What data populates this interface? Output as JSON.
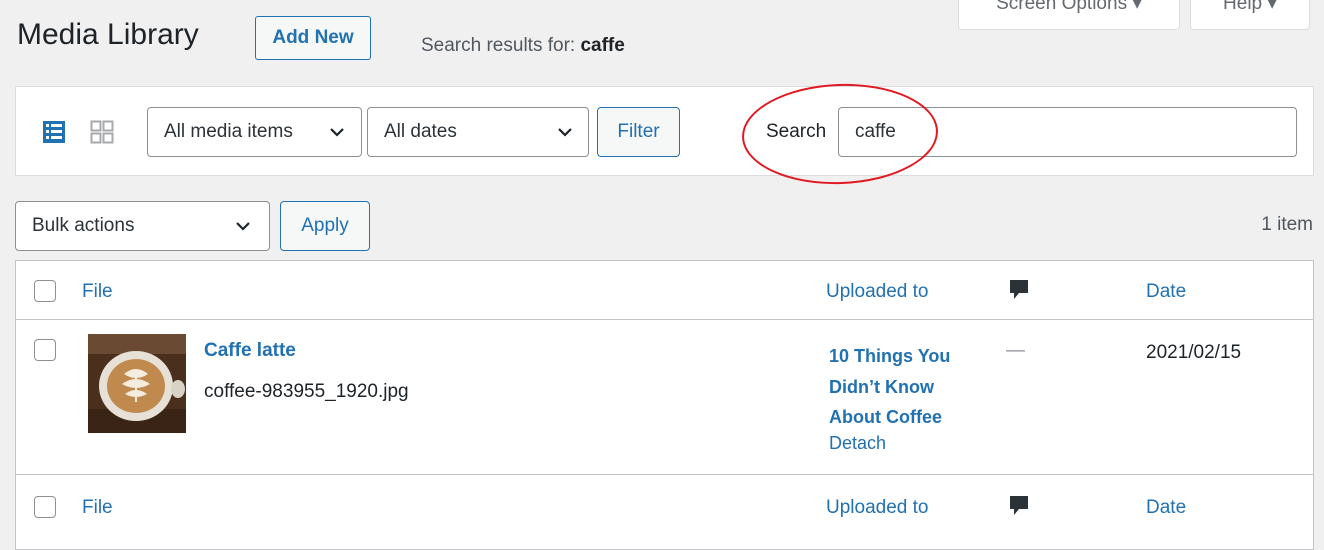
{
  "header": {
    "title": "Media Library",
    "add_new": "Add New",
    "search_results_prefix": "Search results for: ",
    "search_results_term": "caffe",
    "screen_options": "Screen Options ▾",
    "help": "Help ▾"
  },
  "filters": {
    "media_type": "All media items",
    "dates": "All dates",
    "filter_button": "Filter",
    "search_label": "Search",
    "search_value": "caffe"
  },
  "bulk": {
    "selected": "Bulk actions",
    "apply": "Apply",
    "count": "1 item"
  },
  "table": {
    "columns": {
      "file": "File",
      "uploaded_to": "Uploaded to",
      "date": "Date"
    },
    "rows": [
      {
        "title": "Caffe latte",
        "filename": "coffee-983955_1920.jpg",
        "uploaded_to": [
          "10 Things You",
          "Didn’t Know",
          "About Coffee"
        ],
        "detach": "Detach",
        "comments": "—",
        "date": "2021/02/15"
      }
    ]
  },
  "colors": {
    "link": "#2271b1",
    "highlight": "#e01a22",
    "background": "#f0f0f1"
  },
  "icons": {
    "list_view": "list-view-icon",
    "grid_view": "grid-view-icon",
    "comment": "comment-bubble-icon",
    "dropdown": "chevron-down-icon"
  }
}
